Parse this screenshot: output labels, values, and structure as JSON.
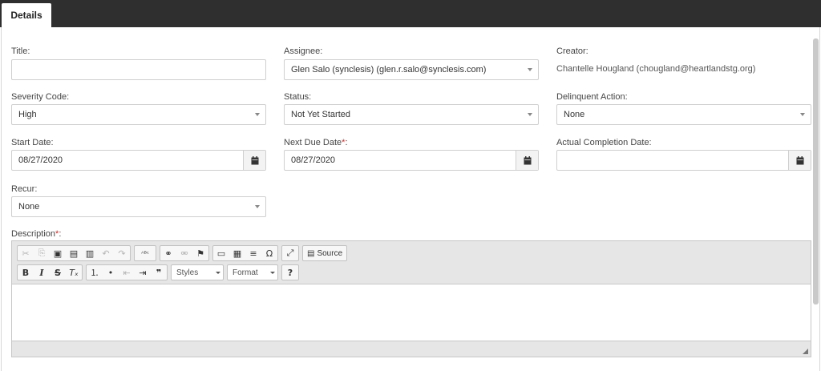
{
  "tab": {
    "label": "Details"
  },
  "form": {
    "title": {
      "label": "Title:",
      "req": "*",
      "suffix": ":",
      "value": ""
    },
    "assignee": {
      "label": "Assignee:",
      "value": "Glen Salo (synclesis) (glen.r.salo@synclesis.com)"
    },
    "creator": {
      "label": "Creator:",
      "value": "Chantelle Hougland (chougland@heartlandstg.org)"
    },
    "severity": {
      "label": "Severity Code:",
      "value": "High"
    },
    "status": {
      "label": "Status:",
      "value": "Not Yet Started"
    },
    "delinquent": {
      "label": "Delinquent Action:",
      "value": "None"
    },
    "start_date": {
      "label": "Start Date:",
      "value": "08/27/2020"
    },
    "next_due": {
      "label": "Next Due Date",
      "req": "*",
      "suffix": ":",
      "value": "08/27/2020"
    },
    "actual_completion": {
      "label": "Actual Completion Date:",
      "value": ""
    },
    "recur": {
      "label": "Recur:",
      "value": "None"
    },
    "description": {
      "label": "Description",
      "req": "*",
      "suffix": ":"
    }
  },
  "editor": {
    "source_label": "Source",
    "styles_label": "Styles",
    "format_label": "Format",
    "help_label": "?",
    "glyphs": {
      "cut": "✂",
      "copy": "⎘",
      "paste": "▣",
      "paste_text": "▤",
      "paste_word": "▥",
      "undo": "↶",
      "redo": "↷",
      "spell": "ᴬᴮᶜ",
      "link": "⚭",
      "unlink": "⚮",
      "anchor": "⚑",
      "image": "▭",
      "table": "▦",
      "hline": "≡",
      "special": "Ω",
      "maximize": "⤢",
      "source_icon": "▤",
      "bold": "B",
      "italic": "I",
      "strike": "S",
      "remove_format": "Tₓ",
      "ol": "⒈",
      "ul": "•",
      "outdent": "⇤",
      "indent": "⇥",
      "blockquote": "❞"
    }
  },
  "icons": {
    "calendar": "calendar-icon",
    "dropdown": "chevron-down-icon"
  }
}
